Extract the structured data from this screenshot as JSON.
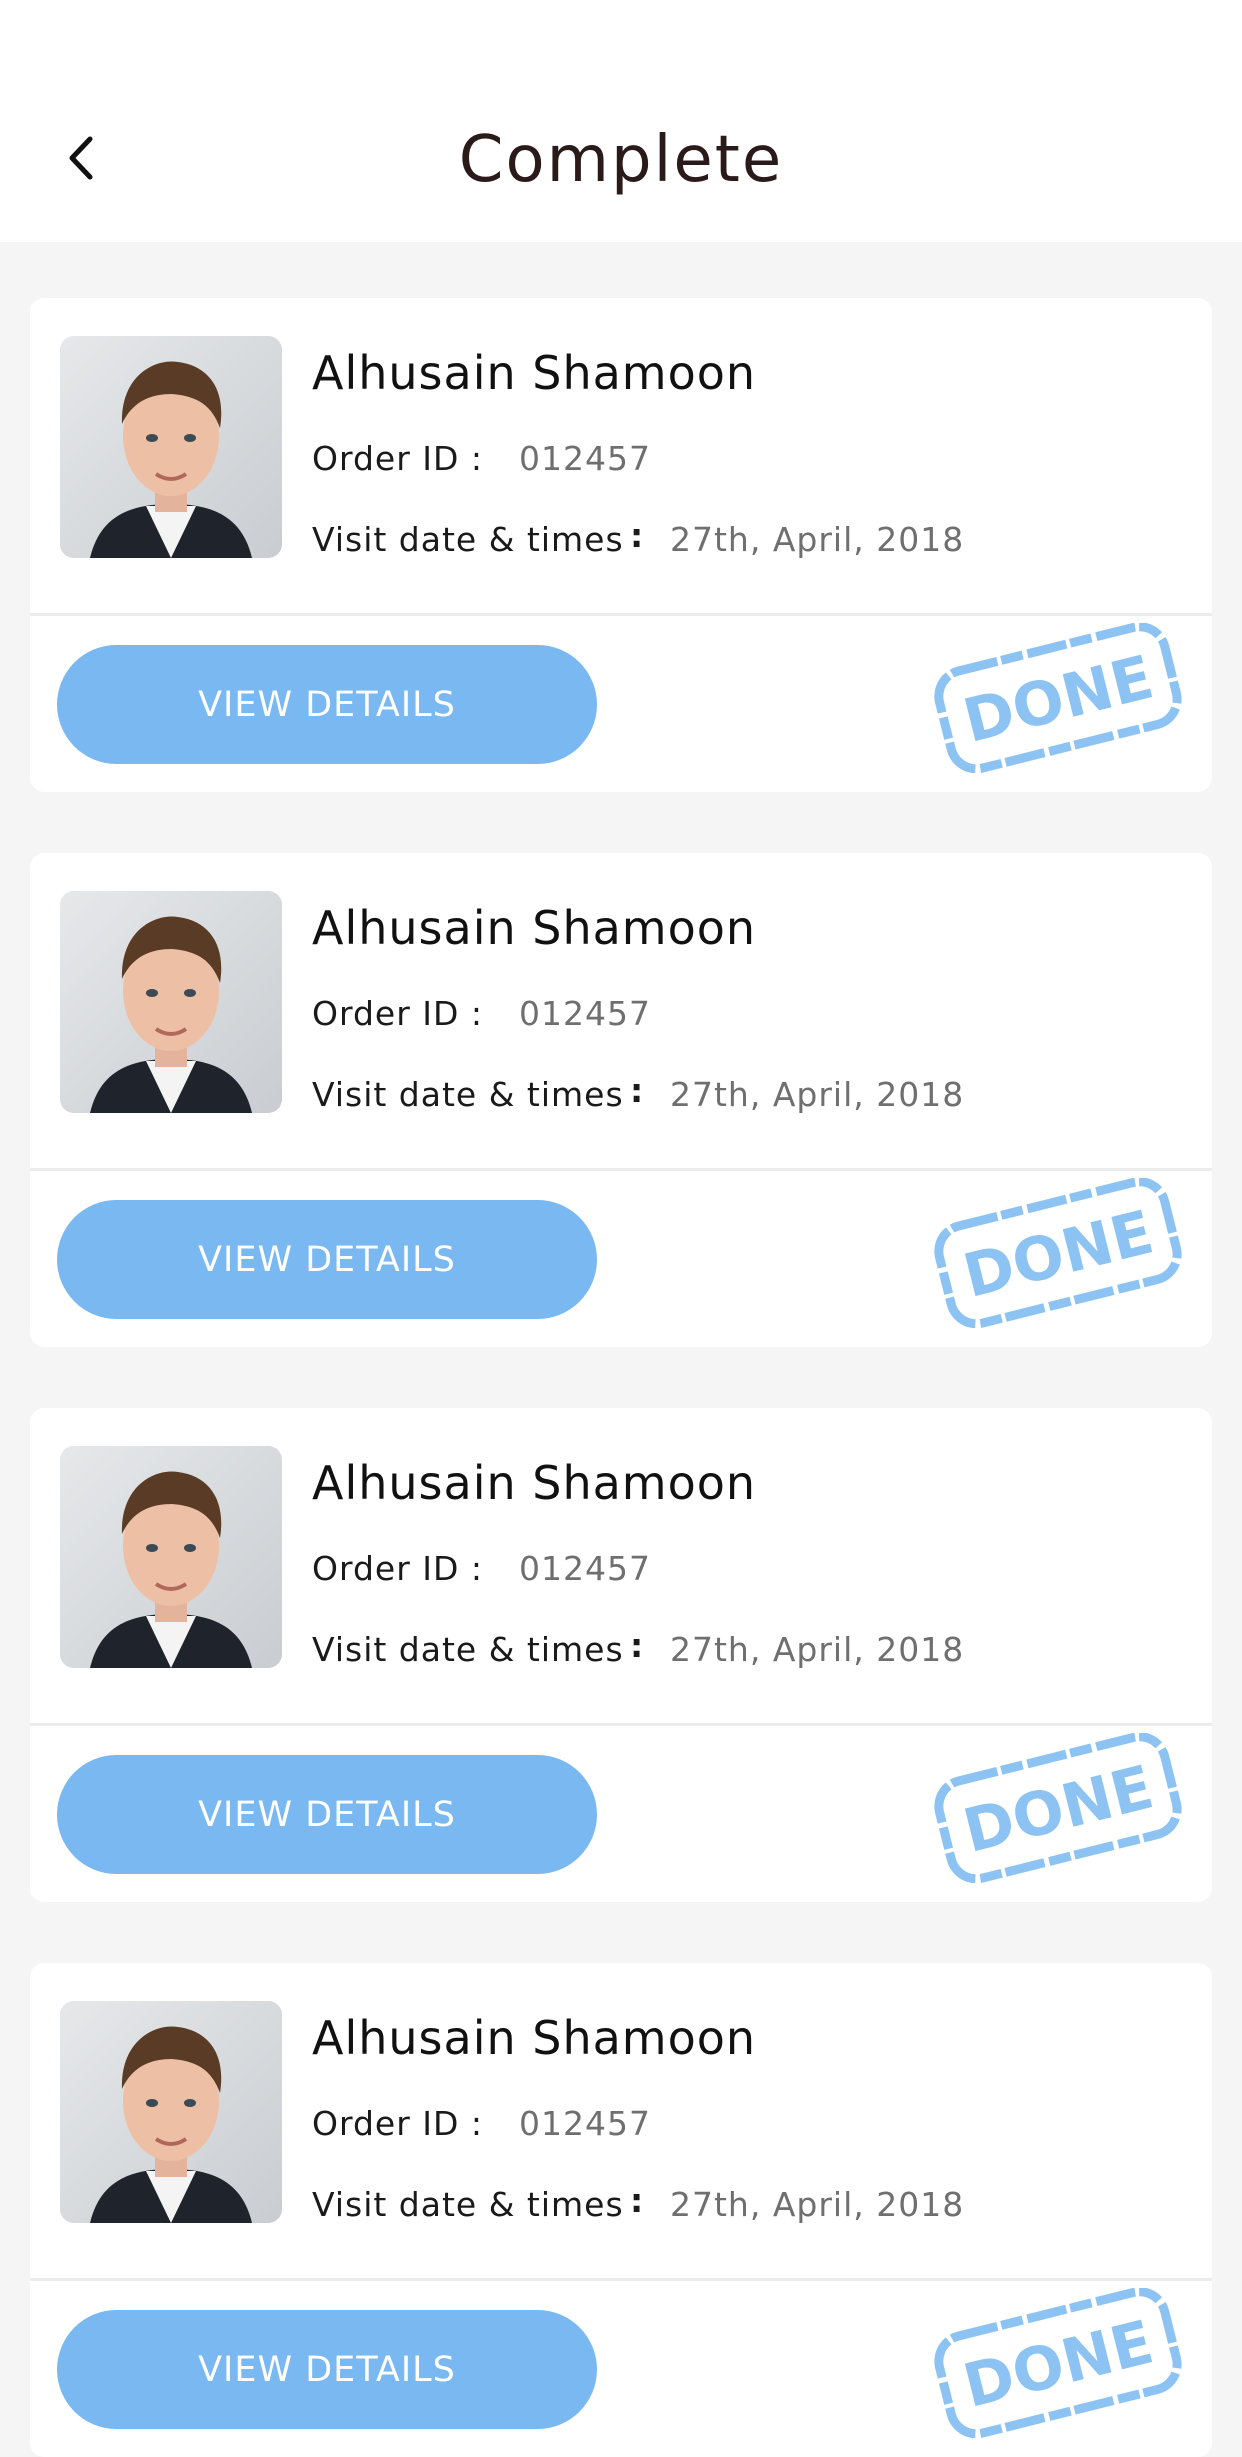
{
  "header": {
    "title": "Complete",
    "back_icon": "chevron-left-icon"
  },
  "colors": {
    "accent": "#7ab8f2",
    "stamp": "#8cc3f2",
    "background": "#f5f5f5"
  },
  "orders": [
    {
      "name": "Alhusain Shamoon",
      "order_label": "Order ID :",
      "order_id": "012457",
      "date_label": "Visit date & times",
      "date_colon": ":",
      "date": "27th, April, 2018",
      "button": "VIEW DETAILS",
      "stamp": "DONE"
    },
    {
      "name": "Alhusain Shamoon",
      "order_label": "Order ID :",
      "order_id": "012457",
      "date_label": "Visit date & times",
      "date_colon": ":",
      "date": "27th, April, 2018",
      "button": "VIEW DETAILS",
      "stamp": "DONE"
    },
    {
      "name": "Alhusain Shamoon",
      "order_label": "Order ID :",
      "order_id": "012457",
      "date_label": "Visit date & times",
      "date_colon": ":",
      "date": "27th, April, 2018",
      "button": "VIEW DETAILS",
      "stamp": "DONE"
    },
    {
      "name": "Alhusain Shamoon",
      "order_label": "Order ID :",
      "order_id": "012457",
      "date_label": "Visit date & times",
      "date_colon": ":",
      "date": "27th, April, 2018",
      "button": "VIEW DETAILS",
      "stamp": "DONE"
    }
  ]
}
